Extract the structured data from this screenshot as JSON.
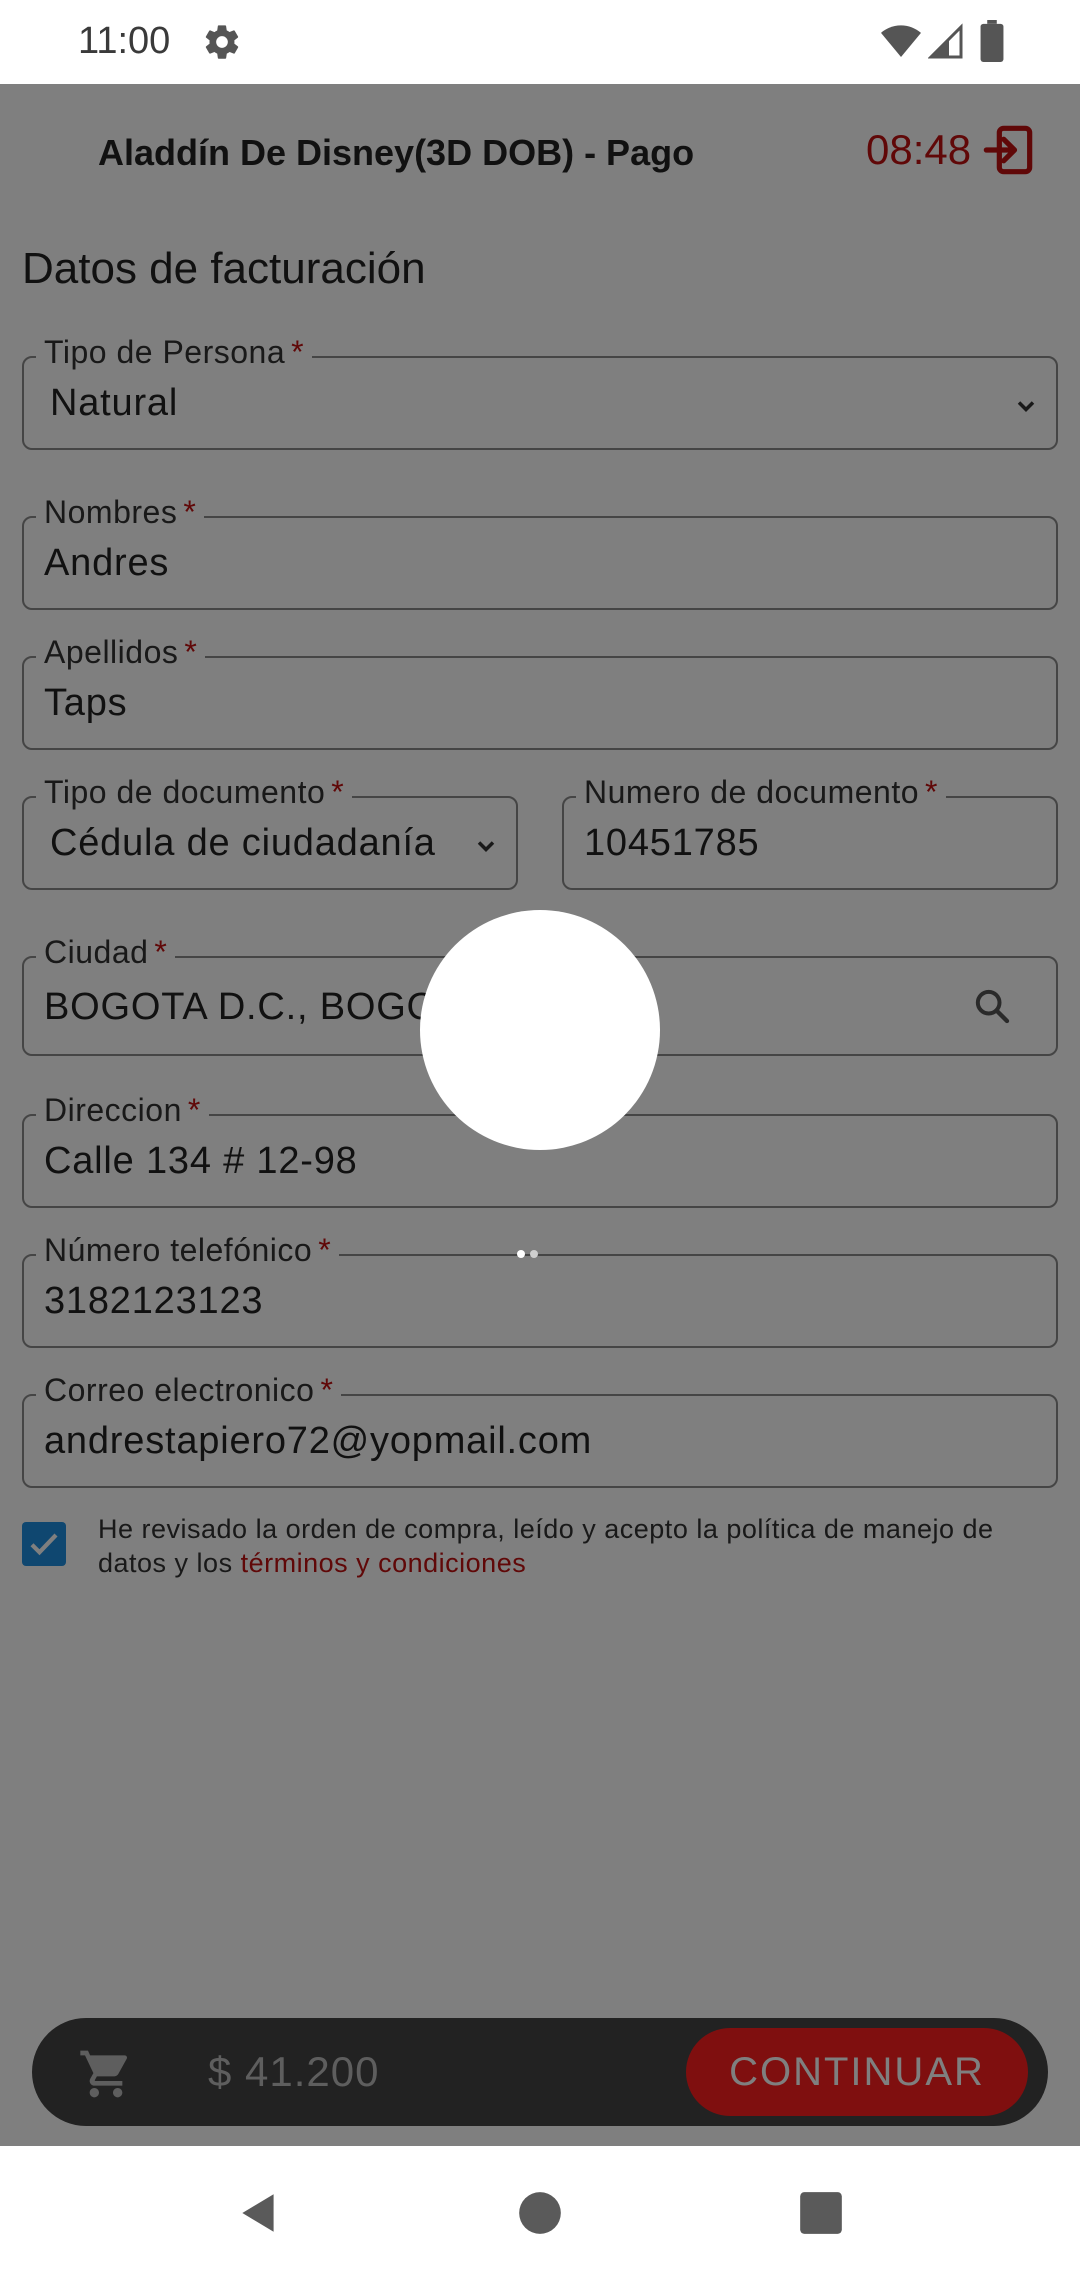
{
  "status_bar": {
    "time": "11:00",
    "icons": [
      "gear-icon",
      "wifi-icon",
      "signal-icon",
      "battery-icon"
    ]
  },
  "header": {
    "title": "Aladdín De Disney(3D DOB) - Pago",
    "timer": "08:48",
    "exit_icon": "exit-icon"
  },
  "form": {
    "section_title": "Datos de facturación",
    "required_mark": "*",
    "tipo_persona": {
      "label": "Tipo de Persona",
      "value": "Natural"
    },
    "nombres": {
      "label": "Nombres",
      "value": "Andres"
    },
    "apellidos": {
      "label": "Apellidos",
      "value": "Taps"
    },
    "tipo_documento": {
      "label": "Tipo de documento",
      "value": "Cédula de ciudadanía"
    },
    "numero_documento": {
      "label": "Numero de documento",
      "value": "10451785"
    },
    "ciudad": {
      "label": "Ciudad",
      "value": "BOGOTA D.C., BOGOT"
    },
    "direccion": {
      "label": "Direccion",
      "value": "Calle 134 # 12-98"
    },
    "telefono": {
      "label": "Número telefónico",
      "value": "3182123123"
    },
    "correo": {
      "label": "Correo electronico",
      "value": "andrestapiero72@yopmail.com"
    },
    "terms": {
      "checked": true,
      "text": "He revisado la orden de compra, leído y acepto la política de manejo de datos y los ",
      "link": "términos y condiciones"
    }
  },
  "cart": {
    "total": "$ 41.200",
    "continue_label": "CONTINUAR"
  },
  "colors": {
    "accent": "#c01010",
    "button": "#ff1f1f",
    "checkbox": "#1e8fe0",
    "overlay": "rgba(0,0,0,0.5)"
  }
}
